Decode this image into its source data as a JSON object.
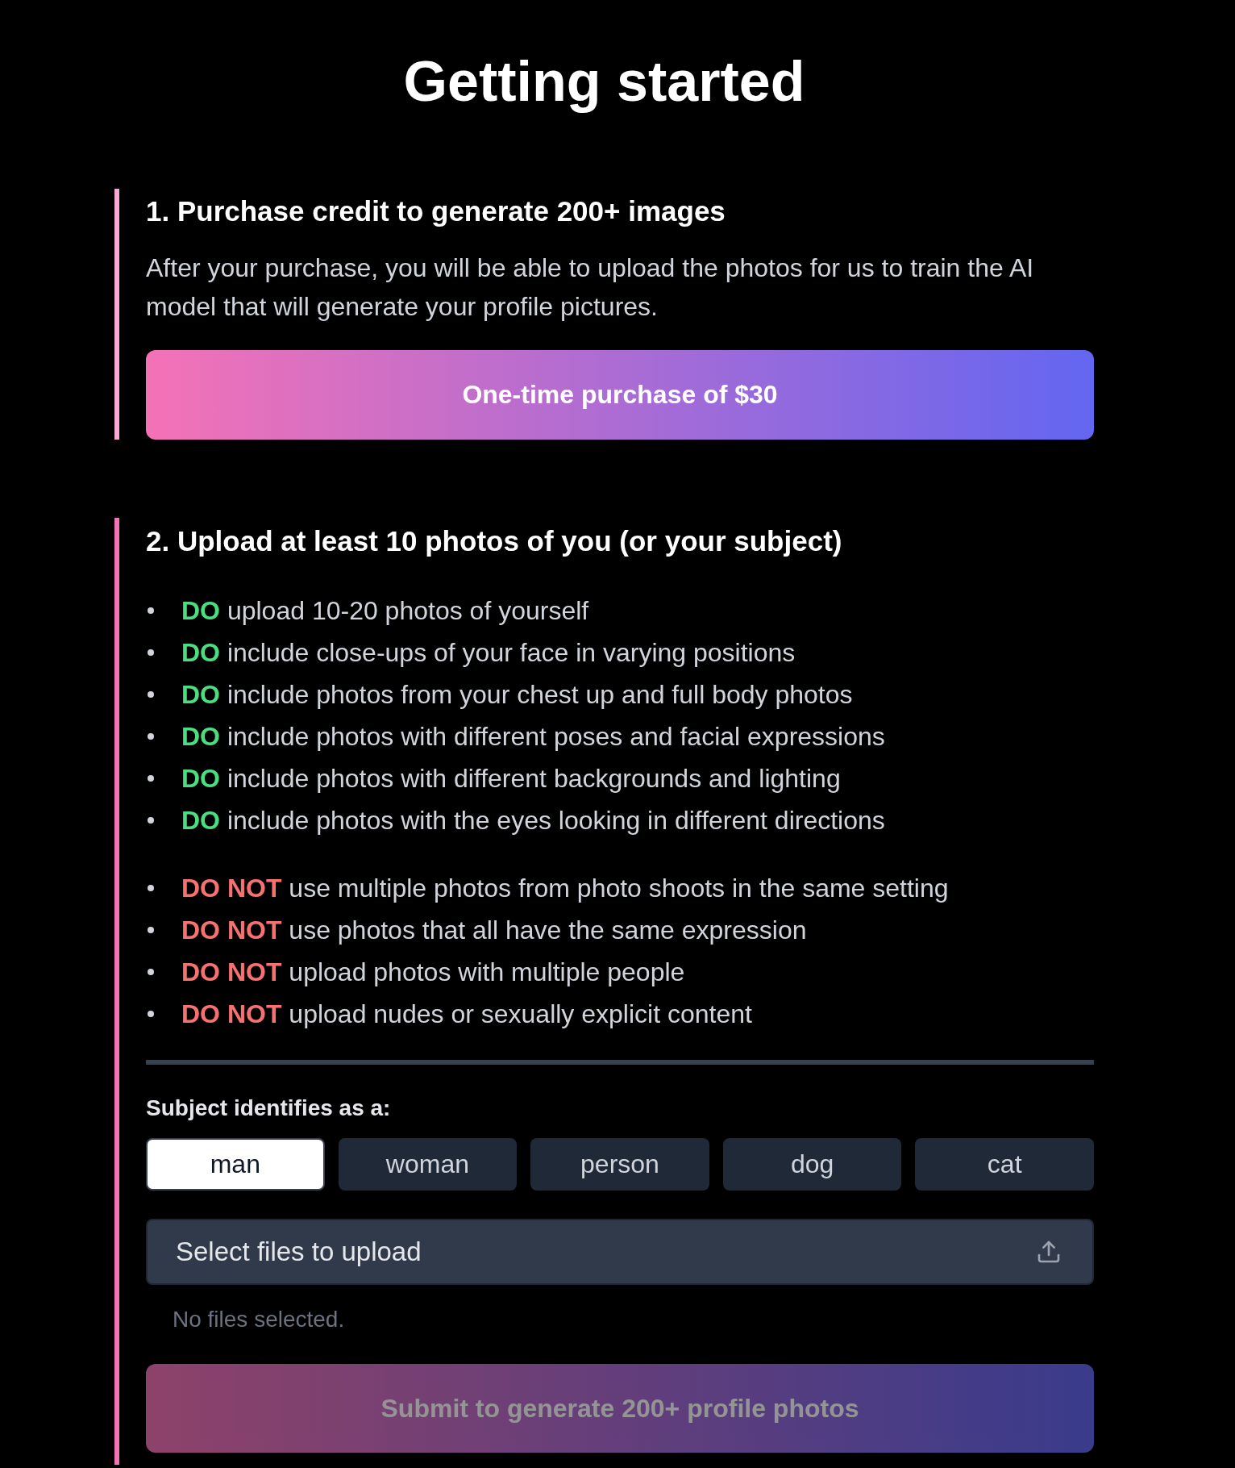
{
  "title": "Getting started",
  "steps": [
    {
      "kind": "purchase",
      "color": "#f9a8d4",
      "heading": "1. Purchase credit to generate 200+ images",
      "description": "After your purchase, you will be able to upload the photos for us to train the AI model that will generate your profile pictures.",
      "purchase_button": "One-time purchase of $30"
    },
    {
      "kind": "upload",
      "color": "#f472b6",
      "heading": "2. Upload at least 10 photos of you (or your subject)",
      "guidelines": [
        {
          "kind": "do",
          "items": [
            {
              "tag": "DO",
              "text": "upload 10-20 photos of yourself"
            },
            {
              "tag": "DO",
              "text": "include close-ups of your face in varying positions"
            },
            {
              "tag": "DO",
              "text": "include photos from your chest up and full body photos"
            },
            {
              "tag": "DO",
              "text": "include photos with different poses and facial expressions"
            },
            {
              "tag": "DO",
              "text": "include photos with different backgrounds and lighting"
            },
            {
              "tag": "DO",
              "text": "include photos with the eyes looking in different directions"
            }
          ]
        },
        {
          "kind": "dont",
          "items": [
            {
              "tag": "DO NOT",
              "text": "use multiple photos from photo shoots in the same setting"
            },
            {
              "tag": "DO NOT",
              "text": "use photos that all have the same expression"
            },
            {
              "tag": "DO NOT",
              "text": "upload photos with multiple people"
            },
            {
              "tag": "DO NOT",
              "text": "upload nudes or sexually explicit content"
            }
          ]
        }
      ],
      "subject": {
        "label": "Subject identifies as a:",
        "options": [
          {
            "label": "man",
            "selected": true
          },
          {
            "label": "woman",
            "selected": false
          },
          {
            "label": "person",
            "selected": false
          },
          {
            "label": "dog",
            "selected": false
          },
          {
            "label": "cat",
            "selected": false
          }
        ]
      },
      "upload": {
        "label": "Select files to upload",
        "status": "No files selected."
      },
      "submit_button": {
        "label": "Submit to generate 200+ profile photos",
        "disabled": true
      }
    }
  ]
}
